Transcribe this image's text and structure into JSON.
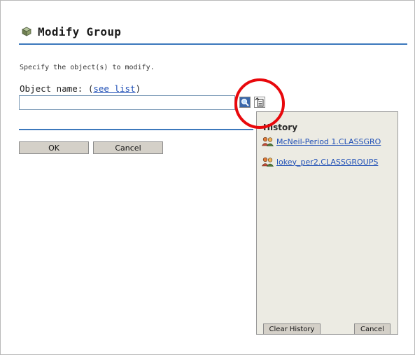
{
  "page": {
    "title": "Modify Group",
    "title_icon": "cube-icon",
    "instructions": "Specify the object(s) to modify."
  },
  "object_name": {
    "label": "Object name:",
    "open_paren": "(",
    "link_text": "see list",
    "close_paren": ")",
    "value": "",
    "placeholder": ""
  },
  "tools": {
    "search_icon": "magnifier-icon",
    "history_icon": "history-list-icon"
  },
  "buttons": {
    "ok": "OK",
    "cancel": "Cancel"
  },
  "history": {
    "title": "History",
    "items": [
      {
        "label": "McNeil-Period 1.CLASSGRO",
        "icon": "group-users-icon"
      },
      {
        "label": "lokey_per2.CLASSGROUPS",
        "icon": "group-users-icon"
      }
    ],
    "clear_label": "Clear History",
    "cancel_label": "Cancel",
    "scroll_left": "<",
    "scroll_right": ">"
  },
  "colors": {
    "rule": "#3c78bc",
    "link": "#1f4fb6",
    "panel_bg": "#ecebe3",
    "highlight_circle": "#e8080c"
  }
}
